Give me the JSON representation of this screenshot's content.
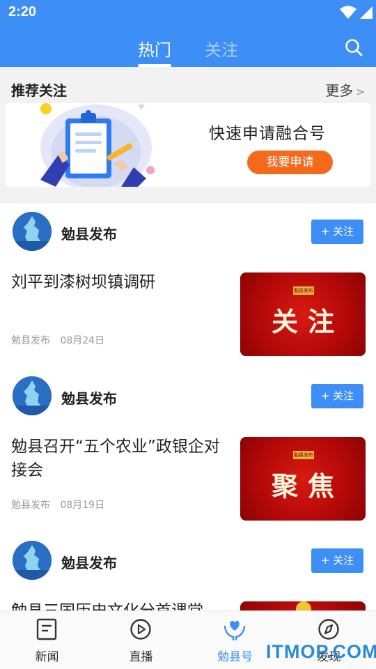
{
  "status_bar": {
    "time": "2:20"
  },
  "header": {
    "tabs": [
      {
        "label": "热门",
        "active": true
      },
      {
        "label": "关注",
        "active": false
      }
    ],
    "search_icon": "search-icon",
    "colors": {
      "primary": "#3d8ff5",
      "accent": "#f56a1a",
      "thumb_red": "#b20808"
    }
  },
  "recommend": {
    "title": "推荐关注",
    "more_label": "更多",
    "more_arrow": ">",
    "card": {
      "text": "快速申请融合号",
      "button_label": "我要申请"
    }
  },
  "feed": [
    {
      "author": "勉县发布",
      "avatar_text": "勉县发布",
      "follow_label": "+ 关注",
      "title": "刘平到漆树坝镇调研",
      "source": "勉县发布",
      "date": "08月24日",
      "thumb_badge": "勉县发布",
      "thumb_word": "关注"
    },
    {
      "author": "勉县发布",
      "avatar_text": "勉县发布",
      "follow_label": "+ 关注",
      "title": "勉县召开“五个农业”政银企对接会",
      "source": "勉县发布",
      "date": "08月19日",
      "thumb_badge": "勉县发布",
      "thumb_word": "聚焦"
    },
    {
      "author": "勉县发布",
      "avatar_text": "勉县发布",
      "follow_label": "+ 关注",
      "title": "勉县三国历史文化分首课堂",
      "source": "",
      "date": "",
      "thumb_badge": "",
      "thumb_word": ""
    }
  ],
  "bottom_nav": [
    {
      "label": "新闻",
      "icon": "news-icon",
      "active": false
    },
    {
      "label": "直播",
      "icon": "play-icon",
      "active": false
    },
    {
      "label": "勉县号",
      "icon": "heart-hands-icon",
      "active": true
    },
    {
      "label": "发现",
      "icon": "compass-icon",
      "active": false
    }
  ],
  "watermark": "ITMOP.COM"
}
